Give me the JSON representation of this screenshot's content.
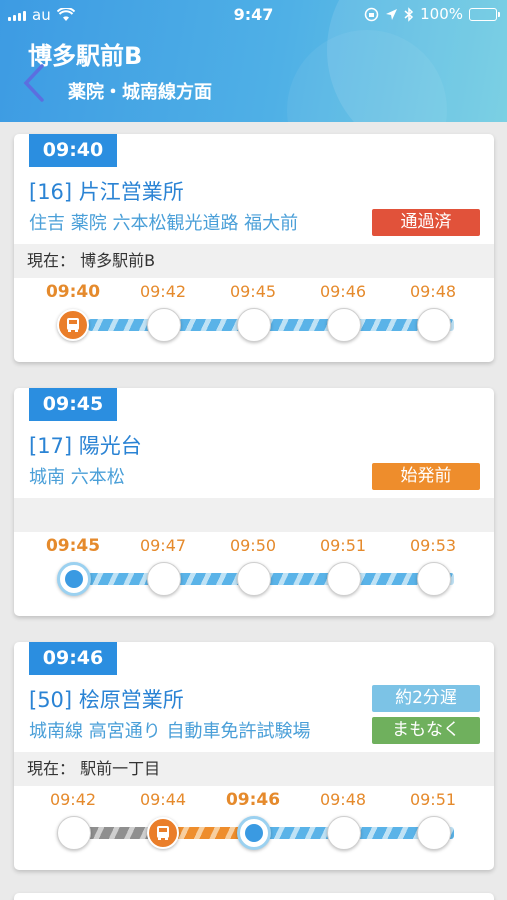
{
  "status_bar": {
    "carrier": "au",
    "time": "9:47",
    "battery": "100%"
  },
  "header": {
    "stop_name": "博多駅前B",
    "direction": "薬院・城南線方面"
  },
  "cards": [
    {
      "depart_time": "09:40",
      "route": "[16] 片江営業所",
      "via": "住吉 薬院 六本松観光道路 福大前",
      "status": "通過済",
      "location": "現在： 博多駅前B",
      "stops": [
        "09:40",
        "09:42",
        "09:45",
        "09:46",
        "09:48"
      ]
    },
    {
      "depart_time": "09:45",
      "route": "[17] 陽光台",
      "via": "城南 六本松",
      "status": "始発前",
      "location": "",
      "stops": [
        "09:45",
        "09:47",
        "09:50",
        "09:51",
        "09:53"
      ]
    },
    {
      "depart_time": "09:46",
      "route": "[50] 桧原営業所",
      "via": "城南線 高宮通り 自動車免許試験場",
      "delay": "約2分遅",
      "status": "まもなく",
      "location": "現在： 駅前一丁目",
      "stops": [
        "09:42",
        "09:44",
        "09:46",
        "09:48",
        "09:51"
      ]
    }
  ],
  "colors": {
    "accent": "#2b8ee0",
    "passed": "#e1523a",
    "before_start": "#ee8d2c",
    "delay": "#7cc3e6",
    "soon": "#6fb05d",
    "bus": "#ea7e2a"
  }
}
